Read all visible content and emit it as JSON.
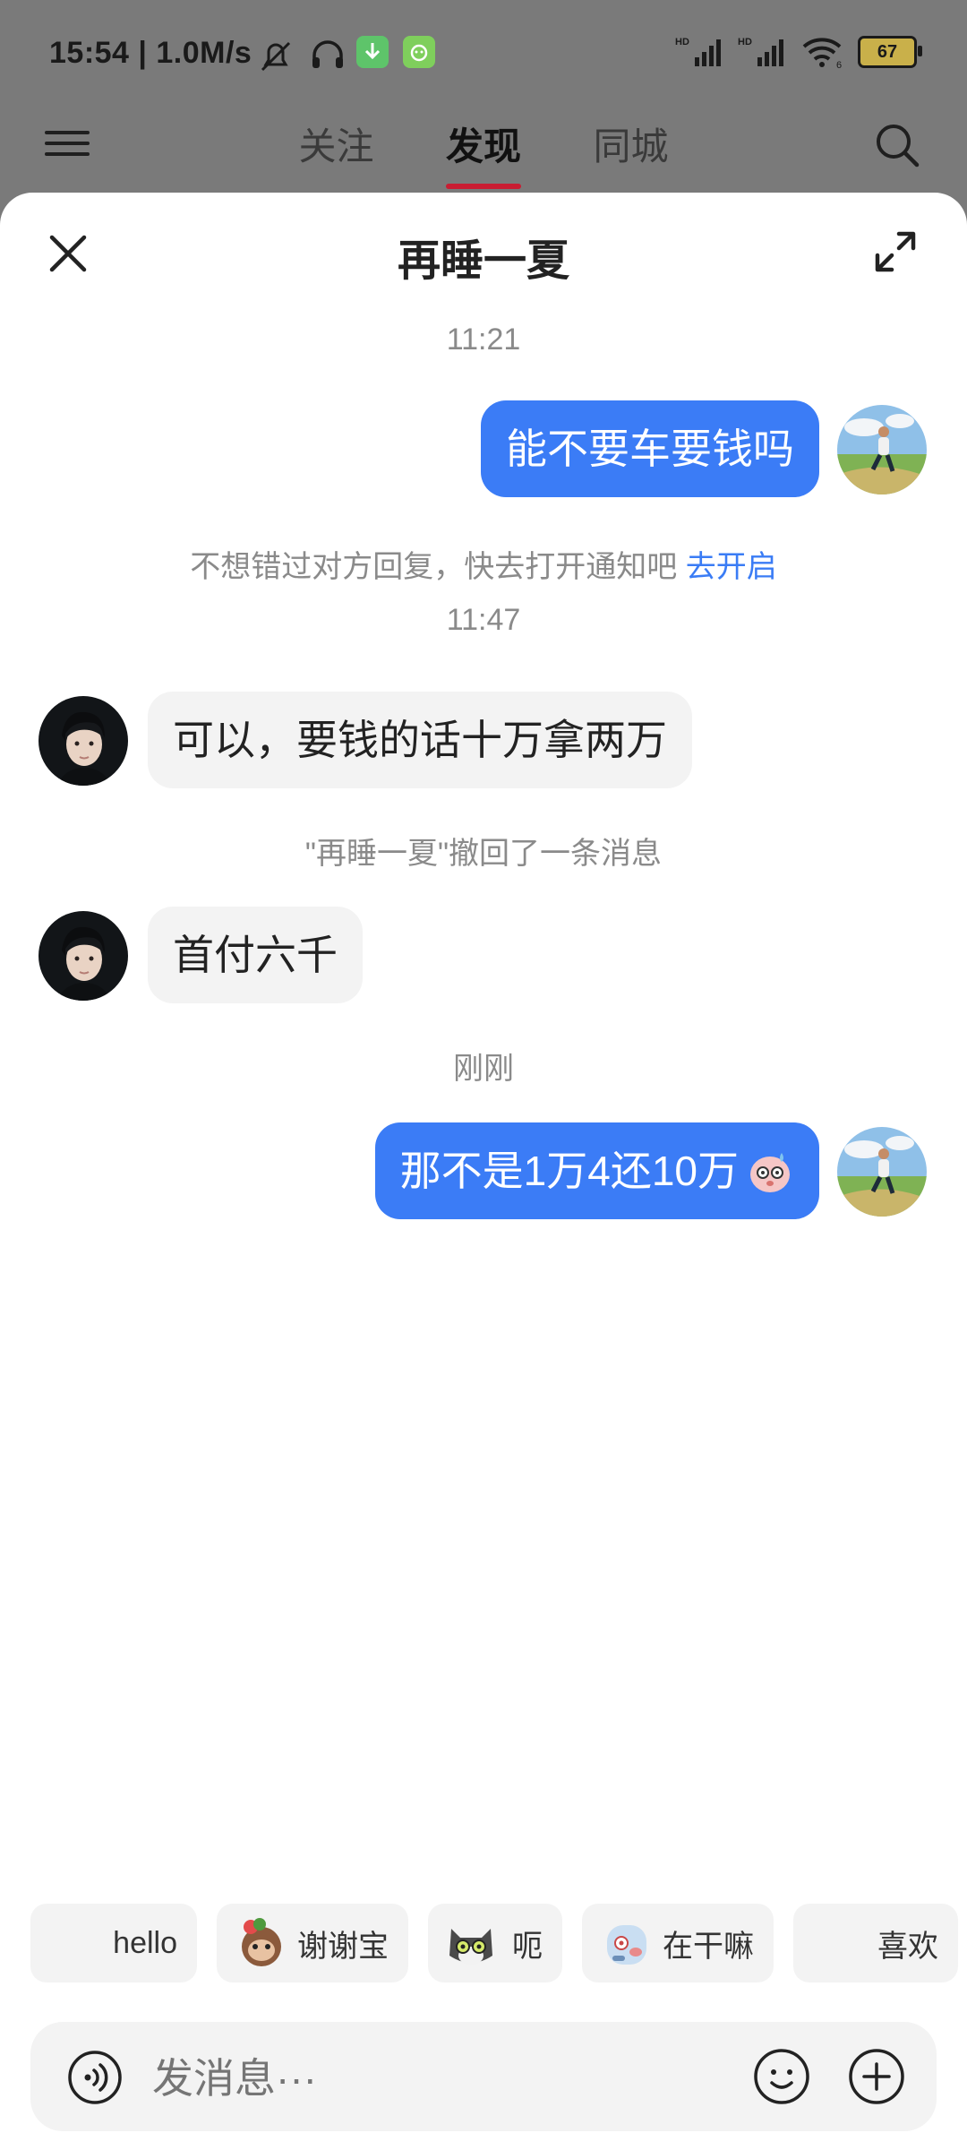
{
  "status_bar": {
    "time": "15:54",
    "speed": "| 1.0M/s",
    "battery": "67"
  },
  "top_nav": {
    "tabs": [
      "关注",
      "发现",
      "同城"
    ],
    "active_tab": "发现"
  },
  "chat": {
    "title": "再睡一夏",
    "timestamps": [
      "11:21",
      "11:47",
      "刚刚"
    ],
    "messages": [
      {
        "from": "me",
        "text": "能不要车要钱吗"
      },
      {
        "from": "other",
        "text": "可以，要钱的话十万拿两万"
      },
      {
        "from": "other",
        "text": "首付六千"
      },
      {
        "from": "me",
        "text": "那不是1万4还10万"
      }
    ],
    "notice": {
      "text": "不想错过对方回复，快去打开通知吧",
      "link": "去开启"
    },
    "recall_text": "\"再睡一夏\"撤回了一条消息"
  },
  "quick_replies": [
    "hello",
    "谢谢宝",
    "呃",
    "在干嘛",
    "喜欢"
  ],
  "input": {
    "placeholder": "发消息···"
  },
  "colors": {
    "accent_blue": "#3b7cf6",
    "tab_underline": "#c91d32",
    "link_blue": "#3a7cf5"
  }
}
